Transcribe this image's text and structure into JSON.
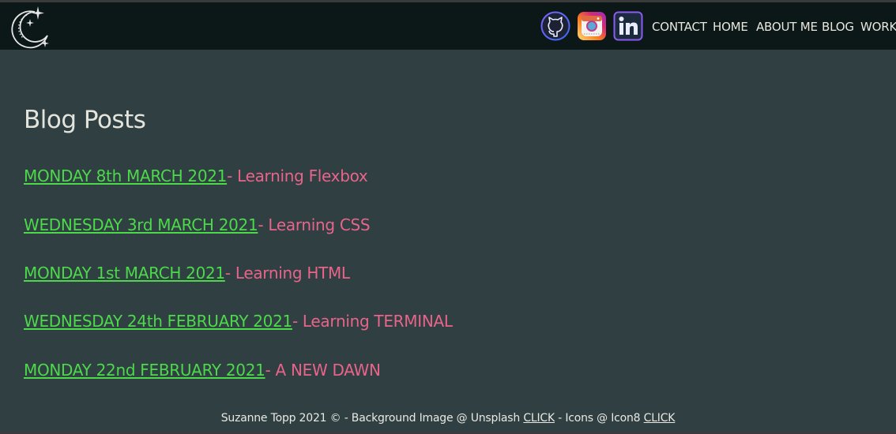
{
  "nav": {
    "logo_icon": "moon-stars-icon",
    "social": [
      {
        "icon": "github-icon"
      },
      {
        "icon": "instagram-icon"
      },
      {
        "icon": "linkedin-icon"
      }
    ],
    "links": [
      "CONTACT",
      "HOME",
      "ABOUT ME",
      "BLOG",
      "WORK"
    ]
  },
  "main": {
    "title": "Blog Posts",
    "posts": [
      {
        "date": "MONDAY 8th MARCH 2021",
        "title": "- Learning Flexbox"
      },
      {
        "date": "WEDNESDAY 3rd MARCH 2021",
        "title": "- Learning CSS"
      },
      {
        "date": "MONDAY 1st MARCH 2021",
        "title": "- Learning HTML"
      },
      {
        "date": "WEDNESDAY 24th FEBRUARY 2021",
        "title": "- Learning TERMINAL"
      },
      {
        "date": "MONDAY 22nd FEBRUARY 2021",
        "title": "- A NEW DAWN"
      }
    ]
  },
  "footer": {
    "text1": "Suzanne Topp 2021 © - Background Image @ Unsplash ",
    "link1": "CLICK",
    "text2": " - Icons @ Icon8 ",
    "link2": "CLICK"
  },
  "colors": {
    "background": "#2f3f42",
    "navbar": "#0b1817",
    "date_link": "#4cd94a",
    "post_title": "#e9648a",
    "text": "#e3e4dc"
  }
}
